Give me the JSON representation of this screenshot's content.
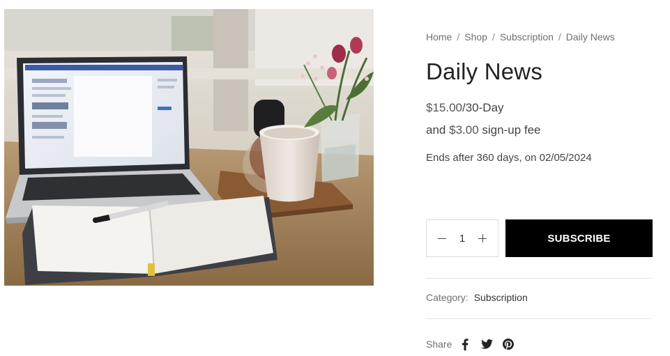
{
  "breadcrumb": {
    "items": [
      "Home",
      "Shop",
      "Subscription",
      "Daily News"
    ],
    "separator": "/"
  },
  "product": {
    "title": "Daily News",
    "price": "$15.00",
    "period": "/30-Day",
    "signup_prefix": "and",
    "signup_amount": "$3.00",
    "signup_suffix": "sign-up fee",
    "ends_text": "Ends after 360 days, on 02/05/2024",
    "image_icon": "product-photo-laptop-notebook-coffee"
  },
  "purchase": {
    "quantity": "1",
    "subscribe_label": "SUBSCRIBE"
  },
  "meta": {
    "category_label": "Category:",
    "category_value": "Subscription"
  },
  "share": {
    "label": "Share",
    "icons": [
      "facebook-icon",
      "twitter-icon",
      "pinterest-icon"
    ]
  },
  "colors": {
    "button_bg": "#000000",
    "button_text": "#ffffff",
    "text_primary": "#222222",
    "text_muted": "#6f6f6f"
  }
}
